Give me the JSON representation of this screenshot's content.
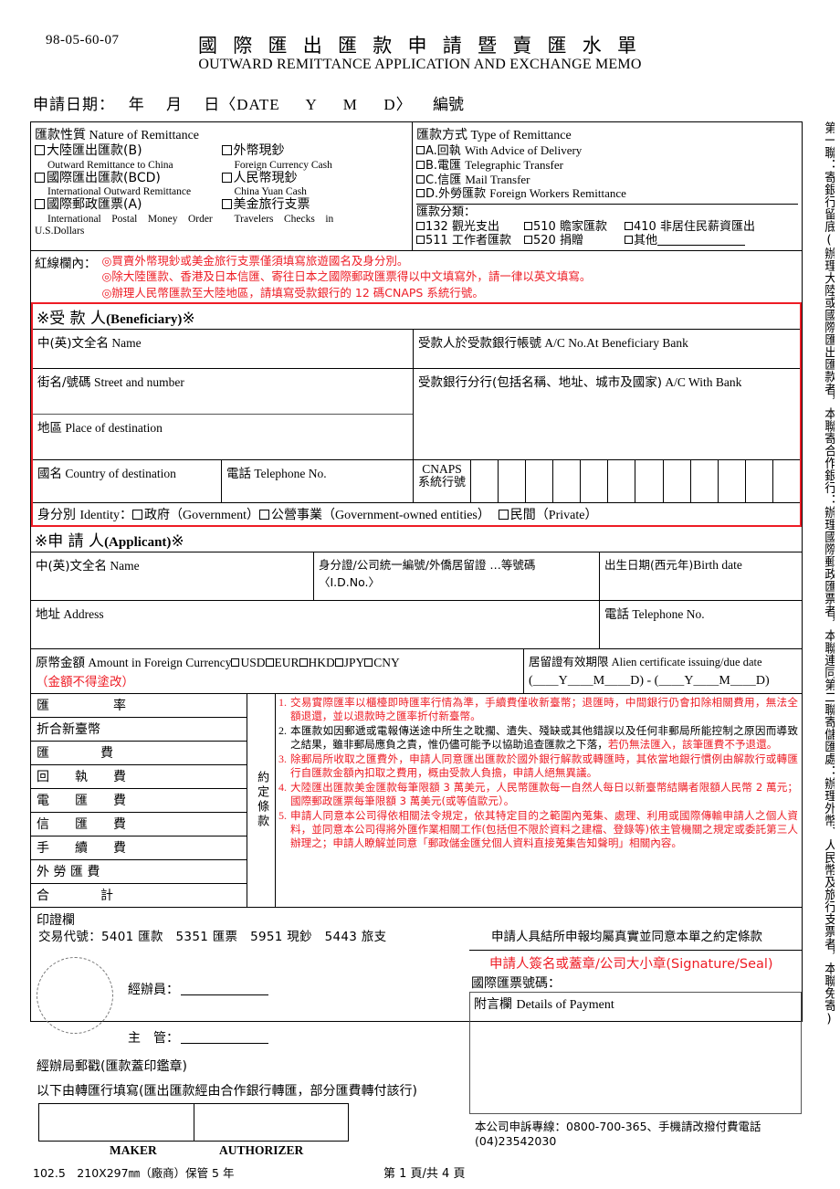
{
  "header": {
    "form_no": "98-05-60-07",
    "title_cn": "國 際 匯 出 匯 款 申 請 暨 賣 匯 水 單",
    "title_en": "OUTWARD REMITTANCE APPLICATION AND EXCHANGE MEMO",
    "date_line": "申請日期：　 年　 月　 日〈DATE 　 Y 　 M 　 D〉",
    "edit_no": "編號"
  },
  "nature": {
    "heading_cn": "匯款性質",
    "heading_en": "Nature of Remittance",
    "left_items": [
      {
        "cn": "大陸匯出匯款(B)",
        "en": "Outward Remittance to China"
      },
      {
        "cn": "國際匯出匯款(BCD)",
        "en": "International Outward Remittance"
      },
      {
        "cn": "國際郵政匯票(A)",
        "en": "International　Postal　Money　Order"
      }
    ],
    "right_items": [
      {
        "cn": "外幣現鈔",
        "en": "Foreign Currency Cash"
      },
      {
        "cn": "人民幣現鈔",
        "en": "China Yuan Cash"
      },
      {
        "cn": "美金旅行支票",
        "en": "Travelers　Checks　in"
      }
    ],
    "usd_tail": "U.S.Dollars"
  },
  "type": {
    "heading_cn": "匯款方式",
    "heading_en": "Type of Remittance",
    "items": [
      {
        "cn": "A.回執",
        "en": "With Advice of Delivery"
      },
      {
        "cn": "B.電匯",
        "en": "Telegraphic Transfer"
      },
      {
        "cn": "C.信匯",
        "en": "Mail Transfer"
      },
      {
        "cn": "D.外勞匯款",
        "en": "Foreign Workers Remittance"
      }
    ],
    "class_heading": "匯款分類：",
    "class_items": [
      "132 觀光支出",
      "510 贍家匯款",
      "410 非居住民薪資匯出",
      "511 工作者匯款",
      "520 捐贈",
      "其他"
    ]
  },
  "notice": {
    "label": "紅線欄內：",
    "lines": [
      "◎買賣外幣現鈔或美金旅行支票僅須填寫旅遊國名及身分別。",
      "◎除大陸匯款、香港及日本信匯、寄往日本之國際郵政匯票得以中文填寫外，請一律以英文填寫。",
      "◎辦理人民幣匯款至大陸地區，請填寫受款銀行的 12 碼CNAPS 系統行號。"
    ]
  },
  "beneficiary": {
    "section_cn": "※受 款 人",
    "section_en": "(Beneficiary)",
    "section_tail": "※",
    "name_cn": "中(英)文全名",
    "name_en": "Name",
    "acno_cn": "受款人於受款銀行帳號",
    "acno_en": "A/C No.At Beneficiary Bank",
    "street_cn": "街名/號碼",
    "street_en": "Street and number",
    "bank_cn": "受款銀行分行(包括名稱、地址、城市及國家)",
    "bank_en": "A/C With Bank",
    "place_cn": "地區",
    "place_en": "Place of destination",
    "country_cn": "國名",
    "country_en": "Country of destination",
    "tel_cn": "電話",
    "tel_en": "Telephone No.",
    "cnaps_label_1": "CNAPS",
    "cnaps_label_2": "系統行號",
    "cnaps_cells": 12,
    "identity_label_cn": "身分別",
    "identity_label_en": "Identity",
    "identity_colon": "：",
    "identity_options": [
      {
        "cn": "政府",
        "en": "（Government）"
      },
      {
        "cn": "公營事業",
        "en": "（Government-owned entities）"
      },
      {
        "cn": "民間",
        "en": "（Private）"
      }
    ]
  },
  "applicant": {
    "section_cn": "※申 請 人",
    "section_en": "(Applicant)",
    "section_tail": "※",
    "name_cn": "中(英)文全名",
    "name_en": "Name",
    "id_cn": "身分證/公司統一編號/外僑居留證 …等號碼",
    "id_en": "〈I.D.No.〉",
    "birth_cn": "出生日期(西元年)",
    "birth_en": "Birth date",
    "addr_cn": "地址",
    "addr_en": "Address",
    "tel_cn": "電話",
    "tel_en": "Telephone No.",
    "amount_cn": "原幣金額",
    "amount_en": "Amount in Foreign Currency",
    "currencies": [
      "USD",
      "EUR",
      "HKD",
      "JPY",
      "CNY"
    ],
    "amount_note": "（金額不得塗改）",
    "alien_cn": "居留證有效期限",
    "alien_en": "Alien certificate issuing/due date",
    "alien_fields": "(＿＿Y＿＿M＿＿D) - (＿＿Y＿＿M＿＿D)"
  },
  "fees": {
    "rows": [
      "匯　　　　　率",
      "折合新臺幣",
      "匯　　　　費",
      "回　　執　　費",
      "電　　匯　　費",
      "信　　匯　　費",
      "手　　續　　費",
      "外 勞 匯 費",
      "合　　　　計"
    ],
    "agreed_label": "約定條款"
  },
  "terms": [
    {
      "n": "1.",
      "text": "交易實際匯率以櫃檯即時匯率行情為準，手續費僅收新臺幣；退匯時，中間銀行仍會扣除相關費用，無法全額退還，並以退款時之匯率折付新臺幣。",
      "color": "red"
    },
    {
      "n": "2.",
      "text": "本匯款如因郵遞或電報傳送途中所生之耽擱、遺失、殘缺或其他錯誤以及任何非郵局所能控制之原因而導致之結果，雖非郵局應負之責，惟仍儘可能予以協助追查匯款之下落，",
      "text2": "若仍無法匯入，該筆匯費不予退還。",
      "color": "black",
      "color2": "red"
    },
    {
      "n": "3.",
      "text": "除郵局所收取之匯費外，申請人同意匯出匯款於國外銀行解款或轉匯時，其依當地銀行慣例由解款行或轉匯行自匯款金額內扣取之費用，概由受款人負擔，申請人絕無異議。",
      "color": "red"
    },
    {
      "n": "4.",
      "text": "大陸匯出匯款美金匯款每筆限額 3 萬美元，人民幣匯款每一自然人每日以新臺幣結購者限額人民幣 2 萬元；國際郵政匯票每筆限額 3 萬美元(或等值歐元）。",
      "color": "red"
    },
    {
      "n": "5.",
      "text": "申請人同意本公司得依相關法令規定，依其特定目的之範圍內蒐集、處理、利用或國際傳輸申請人之個人資料，並同意本公司得將外匯作業相關工作(包括但不限於資料之建檔、登錄等)依主管機關之規定或委託第三人辦理之；申請人瞭解並同意「郵政儲金匯兌個人資料直接蒐集告知聲明」相關內容。",
      "color": "red"
    }
  ],
  "seal_label": "印證欄",
  "bottom": {
    "tx_codes": "交易代號：5401 匯款　5351 匯票　5951 現鈔　5443 旅支",
    "declaration": "申請人具結所申報均屬真實並同意本單之約定條款",
    "clerk_label": "經辦員：",
    "supervisor_label": "主　管：",
    "post_stamp": "經辦局郵戳(匯款蓋印鑑章)",
    "below_bank": "以下由轉匯行填寫(匯出匯款經由合作銀行轉匯，部分匯費轉付該行)",
    "maker": "MAKER",
    "authorizer": "AUTHORIZER",
    "spec": "102.5　210X297㎜（廠商）保管 5 年",
    "page": "第 1 頁/共 4 頁",
    "signature_red": "申請人簽名或蓋章/公司大小章(Signature/Seal)",
    "draft_no": "國際匯票號碼：",
    "details_cn": "附言欄",
    "details_en": "Details of Payment",
    "hotline": "本公司申訴專線：0800-700-365、手機請改撥付費電話(04)23542030"
  },
  "vertical_strip": "第一聯：寄銀行留底(辦理大陸或國際匯出匯款者，本聯寄合作銀行：辦理國際郵政匯票者，本聯連同第二聯寄儲匯處：辦理外幣、人民幣及旅行支票者，本聯免寄)",
  "colors": {
    "red": "#ee1c25",
    "black": "#000000"
  }
}
